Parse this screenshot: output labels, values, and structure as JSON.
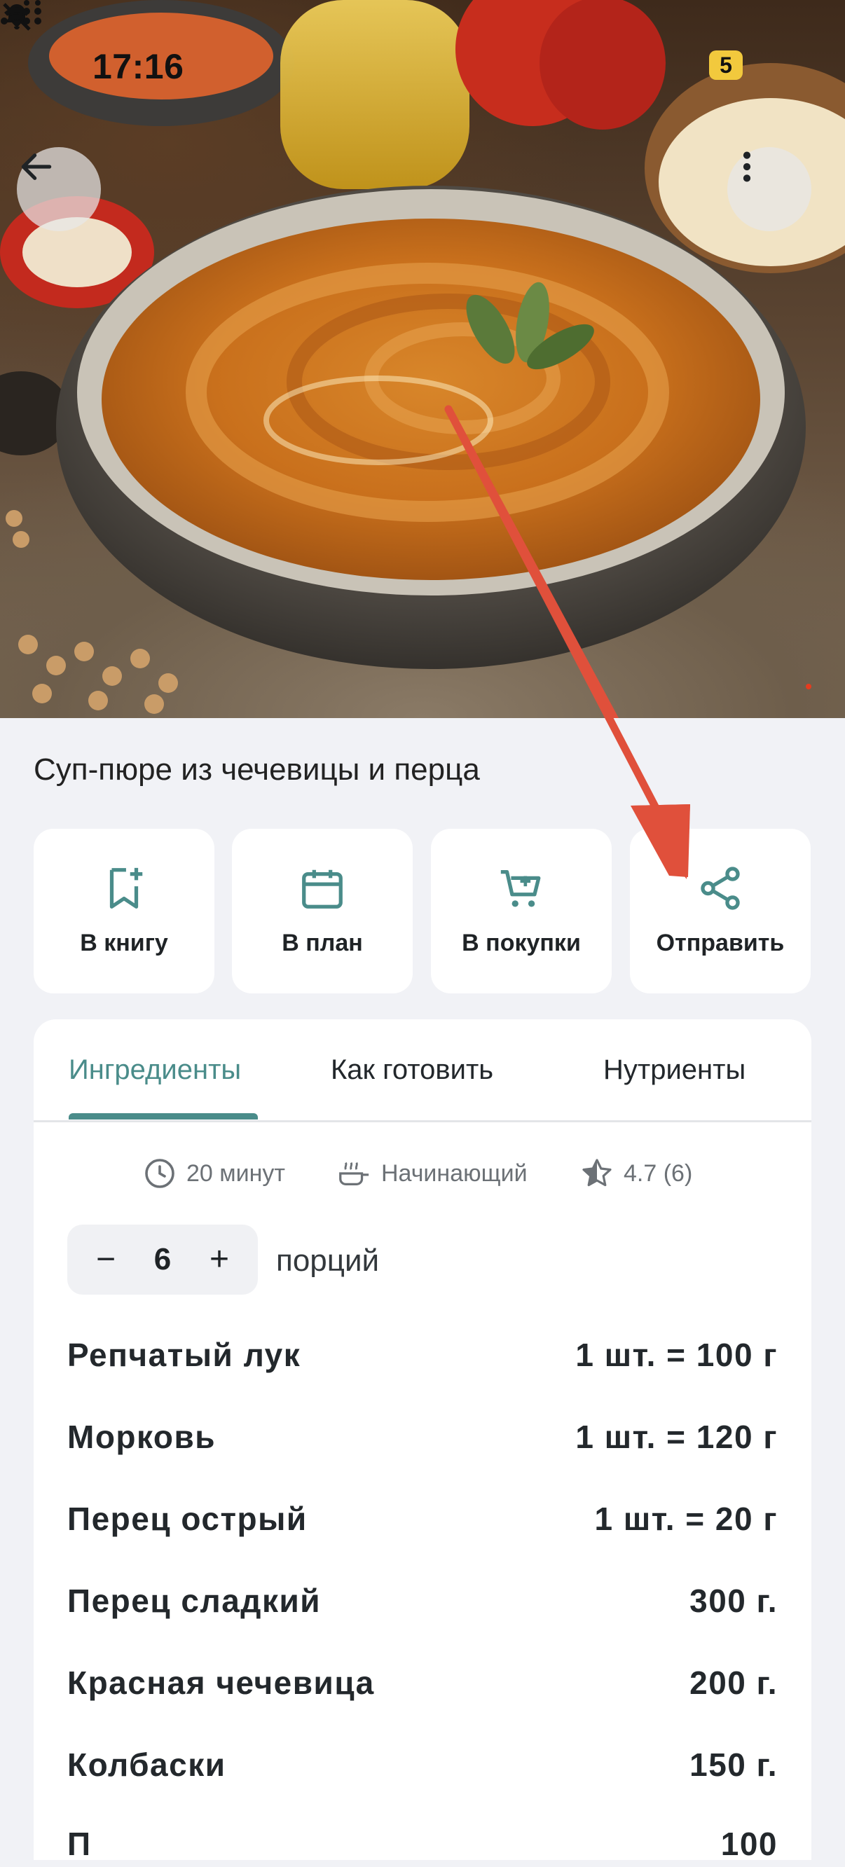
{
  "status_bar": {
    "time": "17:16",
    "battery": "5"
  },
  "recipe": {
    "title": "Суп-пюре из чечевицы и перца"
  },
  "actions": [
    {
      "label": "В книгу",
      "icon": "bookmark-add-icon"
    },
    {
      "label": "В план",
      "icon": "calendar-icon"
    },
    {
      "label": "В покупки",
      "icon": "cart-icon"
    },
    {
      "label": "Отправить",
      "icon": "share-icon"
    }
  ],
  "tabs": [
    {
      "label": "Ингредиенты",
      "active": true
    },
    {
      "label": "Как готовить",
      "active": false
    },
    {
      "label": "Нутриенты",
      "active": false
    }
  ],
  "meta": {
    "time": "20 минут",
    "difficulty": "Начинающий",
    "rating": "4.7 (6)"
  },
  "servings": {
    "minus": "−",
    "count": "6",
    "plus": "+",
    "label": "порций"
  },
  "ingredients": [
    {
      "name": "Репчатый лук",
      "qty": "1 шт. = 100 г"
    },
    {
      "name": "Морковь",
      "qty": "1 шт. = 120 г"
    },
    {
      "name": "Перец острый",
      "qty": "1 шт. = 20 г"
    },
    {
      "name": "Перец сладкий",
      "qty": "300 г."
    },
    {
      "name": "Красная чечевица",
      "qty": "200 г."
    },
    {
      "name": "Колбаски",
      "qty": "150 г."
    }
  ],
  "colors": {
    "accent": "#4a8c8a",
    "annotation_arrow": "#e0503b"
  }
}
